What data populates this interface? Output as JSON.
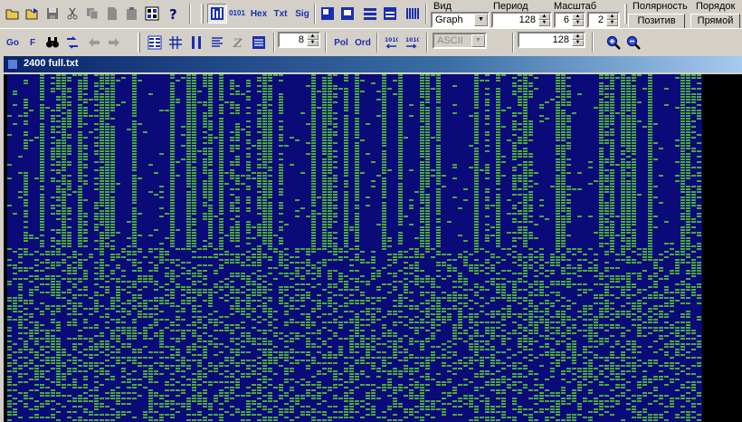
{
  "toolbar1": {
    "buttons": [
      {
        "name": "open-icon",
        "glyph": "open"
      },
      {
        "name": "open-recent-icon",
        "glyph": "openarrow"
      },
      {
        "name": "save-icon",
        "glyph": "save"
      },
      {
        "name": "cut-icon",
        "glyph": "cut"
      },
      {
        "name": "copy-icon",
        "glyph": "copy"
      },
      {
        "name": "new-file-icon",
        "glyph": "page"
      },
      {
        "name": "paste-icon",
        "glyph": "paste"
      },
      {
        "name": "properties-icon",
        "glyph": "props"
      },
      {
        "name": "help-icon",
        "glyph": "help"
      }
    ],
    "mode_buttons": [
      {
        "name": "view-graph-button",
        "glyph": "graph",
        "pressed": true
      },
      {
        "name": "view-binary-button",
        "text": "0101"
      },
      {
        "name": "view-hex-button",
        "text": "Hex"
      },
      {
        "name": "view-text-button",
        "text": "Txt"
      },
      {
        "name": "view-sig-button",
        "text": "Sig"
      }
    ],
    "layout_buttons": [
      {
        "name": "layout-1-icon",
        "glyph": "l1"
      },
      {
        "name": "layout-2-icon",
        "glyph": "l2"
      },
      {
        "name": "layout-3-icon",
        "glyph": "l3"
      },
      {
        "name": "layout-4-icon",
        "glyph": "l4"
      },
      {
        "name": "layout-5-icon",
        "glyph": "l5"
      }
    ]
  },
  "controls": {
    "view_label": "Вид",
    "view_value": "Graph",
    "period_label": "Период",
    "period_value": "128",
    "scale_label": "Масштаб",
    "scale_value1": "6",
    "scale_value2": "2",
    "polarity_label": "Полярность",
    "polarity_button": "Позитив",
    "order_label": "Порядок",
    "order_button": "Прямой"
  },
  "toolbar2": {
    "go_label": "Go",
    "find_label": "F",
    "width_value": "8",
    "pol_label": "Pol",
    "ord_label": "Ord",
    "encoding_value": "ASCII",
    "offset_value": "128"
  },
  "document": {
    "title": "2400 full.txt"
  },
  "colors": {
    "bit_one": "#4caa3c",
    "bit_zero": "#0a0a78",
    "background": "#000000",
    "title_bar": "#0a246a"
  }
}
